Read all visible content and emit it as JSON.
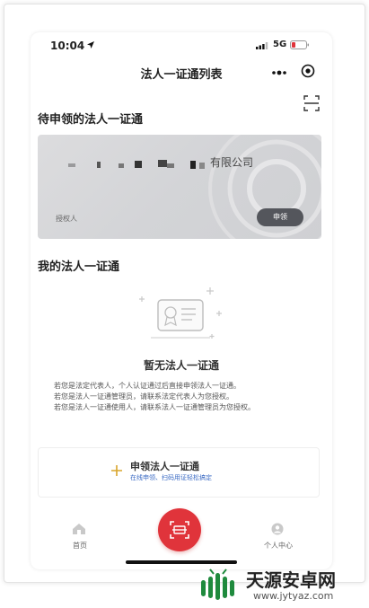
{
  "status_bar": {
    "time": "10:04",
    "network": "5G"
  },
  "nav": {
    "title": "法人一证通列表"
  },
  "pending": {
    "section_title": "待申领的法人一证通",
    "card": {
      "company_suffix": "有限公司",
      "authorizer_label": "授权人",
      "apply_button": "申领"
    }
  },
  "mine": {
    "section_title": "我的法人一证通",
    "empty_title": "暂无法人一证通",
    "description": [
      "若您是法定代表人，个人认证通过后直接申领法人一证通。",
      "若您是法人一证通管理员，请联系法定代表人为您授权。",
      "若您是法人一证通使用人，请联系法人一证通管理员为您授权。"
    ]
  },
  "apply_box": {
    "title": "申领法人一证通",
    "subtitle": "在线申领、扫码用证轻松搞定"
  },
  "tabbar": {
    "home_label": "首页",
    "profile_label": "个人中心"
  },
  "watermark": {
    "brand": "天源安卓网",
    "url": "www.jytyaz.com"
  },
  "colors": {
    "accent_red": "#e0343b",
    "button_dark": "#54565c",
    "link_blue": "#3b6bc4",
    "plus_gold": "#d8a52b"
  }
}
